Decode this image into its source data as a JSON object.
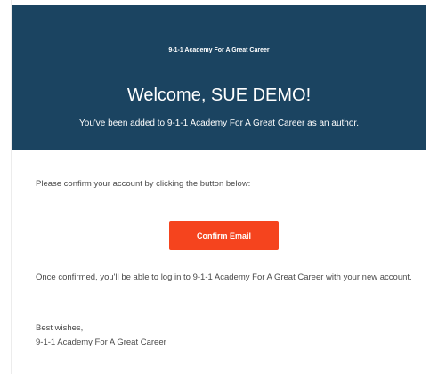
{
  "header": {
    "brand": "9-1-1 Academy For A Great Career",
    "title": "Welcome, SUE DEMO!",
    "subtitle": "You've been added to 9-1-1 Academy For A Great Career as an author."
  },
  "body": {
    "instruction": "Please confirm your account by clicking the button below:",
    "confirm_label": "Confirm Email",
    "after_confirm": "Once confirmed, you'll be able to log in to 9-1-1 Academy For A Great Career with your new account.",
    "signoff": "Best wishes,",
    "signature": "9-1-1 Academy For A Great Career"
  },
  "colors": {
    "header_background": "#1b4461",
    "button_background": "#f5441e"
  }
}
